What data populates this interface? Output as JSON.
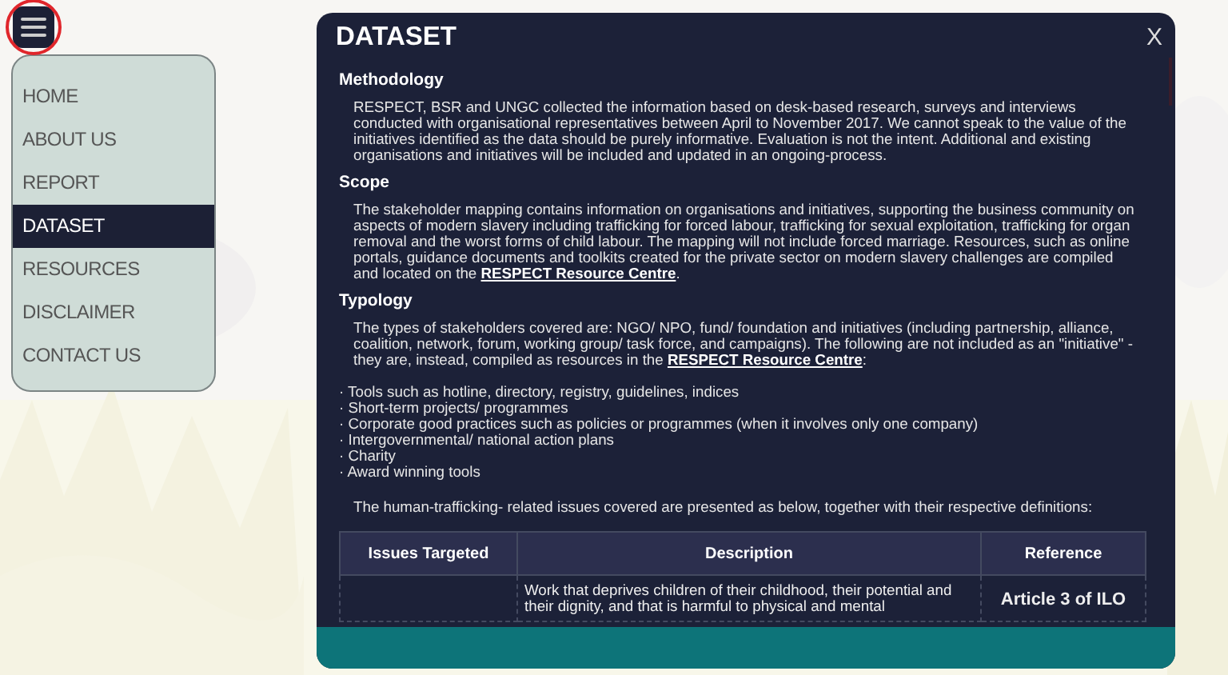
{
  "menu": {
    "items": [
      {
        "label": "HOME",
        "selected": false
      },
      {
        "label": "ABOUT US",
        "selected": false
      },
      {
        "label": "REPORT",
        "selected": false
      },
      {
        "label": "DATASET",
        "selected": true
      },
      {
        "label": "RESOURCES",
        "selected": false
      },
      {
        "label": "DISCLAIMER",
        "selected": false
      },
      {
        "label": "CONTACT US",
        "selected": false
      }
    ]
  },
  "dialog": {
    "title": "DATASET",
    "close": "X",
    "sections": [
      {
        "heading": "Methodology",
        "blocks": [
          {
            "kind": "paragraph",
            "text": "RESPECT, BSR and UNGC collected the information based on desk-based research, surveys and interviews conducted with organisational representatives between April to November 2017. We cannot speak to the value of the initiatives identified as the data should be purely informative. Evaluation is not the intent. Additional and existing organisations and initiatives will be included and updated in an ongoing-process."
          }
        ]
      },
      {
        "heading": "Scope",
        "blocks": [
          {
            "kind": "paragraph",
            "text": "The stakeholder mapping contains information on organisations and initiatives, supporting the business community on aspects of modern slavery including trafficking for forced labour, trafficking for sexual exploitation, trafficking for organ removal and the worst forms of child labour. The mapping will not include forced marriage. Resources, such as online portals, guidance documents and toolkits created for the private sector on modern slavery challenges are compiled and located on the",
            "link": "RESPECT Resource Centre",
            "after": "."
          }
        ]
      },
      {
        "heading": "Typology",
        "blocks": [
          {
            "kind": "paragraph",
            "text": "The types of stakeholders covered are: NGO/ NPO, fund/ foundation and initiatives (including partnership, alliance, coalition, network, forum, working group/ task force, and campaigns). The following are not included as an \"initiative\" - they are, instead, compiled as resources in the",
            "link": "RESPECT Resource Centre",
            "after": ":"
          },
          {
            "kind": "list",
            "items": [
              "· Tools such as hotline, directory, registry, guidelines, indices",
              "· Short-term projects/ programmes",
              "· Corporate good practices such as policies or programmes (when it involves only one company)",
              "· Intergovernmental/ national action plans",
              "· Charity",
              "· Award winning tools"
            ]
          },
          {
            "kind": "paragraph",
            "text": "The human-trafficking- related issues covered are presented as below, together with their respective definitions:"
          },
          {
            "kind": "table",
            "columns": [
              "Issues Targeted",
              "Description",
              "Reference"
            ],
            "rows": [
              [
                "",
                "Work that deprives children of their childhood, their potential and their dignity, and that is harmful to physical and mental",
                "Article 3 of ILO"
              ]
            ]
          }
        ]
      }
    ]
  }
}
